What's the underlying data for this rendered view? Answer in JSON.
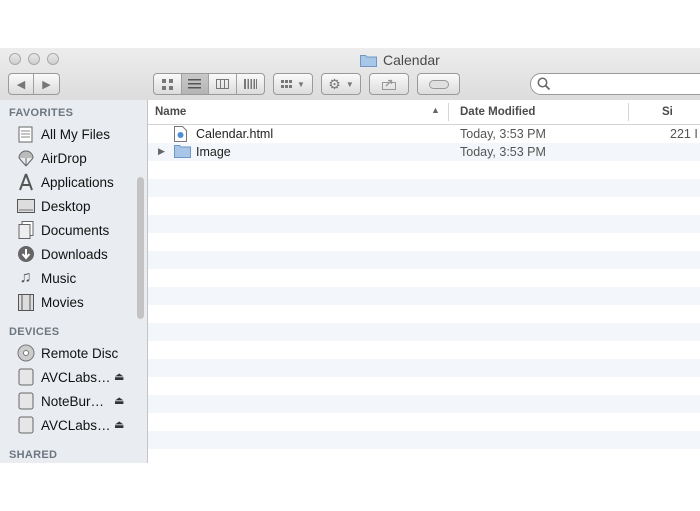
{
  "window": {
    "title": "Calendar"
  },
  "sidebar": {
    "favorites_header": "FAVORITES",
    "favorites": [
      {
        "label": "All My Files",
        "icon": "all-files-icon"
      },
      {
        "label": "AirDrop",
        "icon": "airdrop-icon"
      },
      {
        "label": "Applications",
        "icon": "applications-icon"
      },
      {
        "label": "Desktop",
        "icon": "desktop-icon"
      },
      {
        "label": "Documents",
        "icon": "documents-icon"
      },
      {
        "label": "Downloads",
        "icon": "downloads-icon"
      },
      {
        "label": "Music",
        "icon": "music-icon"
      },
      {
        "label": "Movies",
        "icon": "movies-icon"
      }
    ],
    "devices_header": "DEVICES",
    "devices": [
      {
        "label": "Remote Disc",
        "icon": "disc-icon",
        "eject": false
      },
      {
        "label": "AVCLabs…",
        "icon": "drive-icon",
        "eject": true
      },
      {
        "label": "NoteBur…",
        "icon": "drive-icon",
        "eject": true
      },
      {
        "label": "AVCLabs…",
        "icon": "drive-icon",
        "eject": true
      }
    ],
    "shared_header": "SHARED"
  },
  "columns": {
    "name": "Name",
    "date": "Date Modified",
    "size": "Si"
  },
  "files": [
    {
      "name": "Calendar.html",
      "date": "Today, 3:53 PM",
      "size": "221 I",
      "icon": "html-file-icon",
      "folder": false
    },
    {
      "name": "Image",
      "date": "Today, 3:53 PM",
      "size": "",
      "icon": "folder-icon",
      "folder": true
    }
  ]
}
